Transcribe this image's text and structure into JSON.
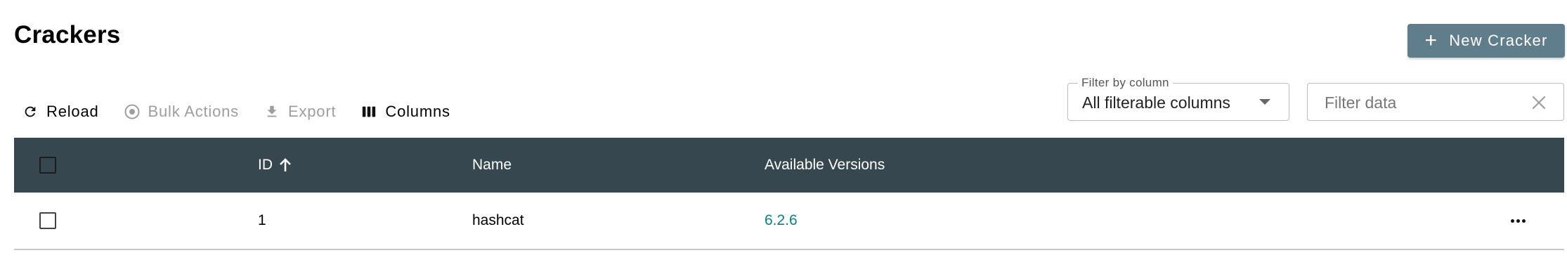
{
  "page": {
    "title": "Crackers",
    "new_button_label": "New Cracker",
    "new_button_icon": "plus-icon",
    "accent_color": "#607d8b"
  },
  "toolbar": {
    "reload_label": "Reload",
    "bulk_actions_label": "Bulk Actions",
    "export_label": "Export",
    "columns_label": "Columns"
  },
  "filters": {
    "column_filter_label": "Filter by column",
    "column_filter_value": "All filterable columns",
    "search_placeholder": "Filter data",
    "search_value": ""
  },
  "table": {
    "header_color": "#37474f",
    "columns": [
      "ID",
      "Name",
      "Available Versions"
    ],
    "sort": {
      "column": "ID",
      "direction": "ascending"
    },
    "rows": [
      {
        "id": "1",
        "name": "hashcat",
        "versions": "6.2.6"
      }
    ]
  }
}
